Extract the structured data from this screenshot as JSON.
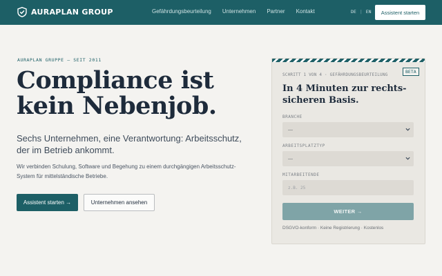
{
  "brand": {
    "name": "AURAPLAN GROUP",
    "accent": "#1d5f66"
  },
  "nav": {
    "items": [
      "Gefährdungsbeurteilung",
      "Unternehmen",
      "Partner",
      "Kontakt"
    ],
    "lang": {
      "de": "DE",
      "sep": "|",
      "en": "EN"
    },
    "cta": "Assistent starten"
  },
  "hero": {
    "eyebrow": "AURAPLAN GRUPPE — SEIT 2011",
    "headline": [
      "Compliance ist",
      "kein Nebenjob."
    ],
    "subhead": "Sechs Unternehmen, eine Verantwortung: Arbeitsschutz, der im Betrieb ankommt.",
    "body": "Wir verbinden Schulung, Software und Begehung zu einem durchgängigen Arbeitsschutz-System für mittelständische Betriebe.",
    "primary_button": "Assistent starten →",
    "secondary_button": "Unternehmen ansehen"
  },
  "wizard": {
    "step": "SCHRITT 1 VON 4 · GEFÄHRDUNGSBEURTEILUNG",
    "badge": "BETA",
    "title": "In 4 Minuten zur rechts-sicheren Basis.",
    "fields": {
      "branche": {
        "label": "BRANCHE",
        "value": "—"
      },
      "arbeitsplatztyp": {
        "label": "ARBEITSPLATZTYP",
        "value": "—"
      },
      "mitarbeitende": {
        "label": "MITARBEITENDE",
        "placeholder": "z.B. 25"
      }
    },
    "submit": "WEITER →",
    "footnote": "DSGVO-konform · Keine Registrierung · Kostenlos"
  },
  "icons": {
    "logo": "shield-check-icon",
    "select": "chevron-down-icon"
  }
}
